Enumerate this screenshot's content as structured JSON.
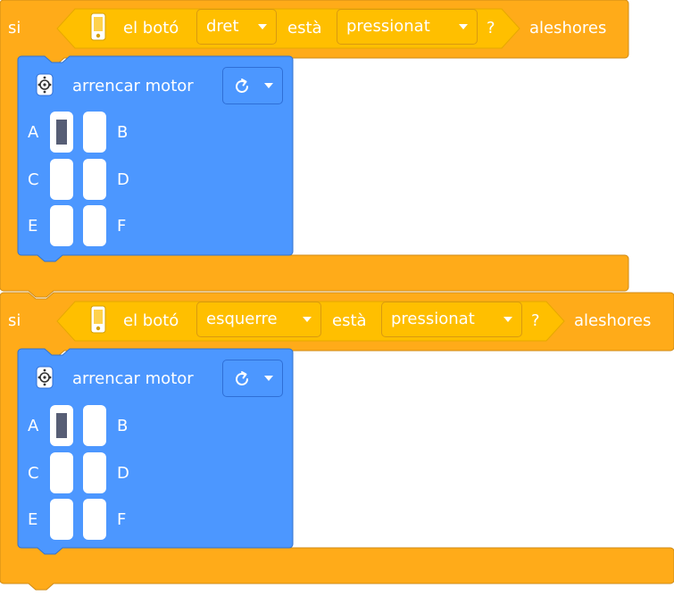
{
  "colors": {
    "control": "#ffab19",
    "control_dark": "#cf8b17",
    "sensing": "#ffbf00",
    "sensing_dark": "#e6a800",
    "motion": "#4c97ff",
    "motion_dark": "#3373cc",
    "port_active": "#575e75"
  },
  "blocks": [
    {
      "if_label": "si",
      "then_label": "aleshores",
      "condition": {
        "icon": "hub-icon",
        "text": "el botó",
        "button_value": "dret",
        "is_text": "està",
        "state_value": "pressionat",
        "question": "?"
      },
      "action": {
        "icon": "motor-icon",
        "text": "arrencar motor",
        "direction_icon": "rotate-clockwise-icon",
        "ports": [
          {
            "label": "A",
            "active": true
          },
          {
            "label": "B",
            "active": false
          },
          {
            "label": "C",
            "active": false
          },
          {
            "label": "D",
            "active": false
          },
          {
            "label": "E",
            "active": false
          },
          {
            "label": "F",
            "active": false
          }
        ]
      }
    },
    {
      "if_label": "si",
      "then_label": "aleshores",
      "condition": {
        "icon": "hub-icon",
        "text": "el botó",
        "button_value": "esquerre",
        "is_text": "està",
        "state_value": "pressionat",
        "question": "?"
      },
      "action": {
        "icon": "motor-icon",
        "text": "arrencar motor",
        "direction_icon": "rotate-clockwise-icon",
        "ports": [
          {
            "label": "A",
            "active": true
          },
          {
            "label": "B",
            "active": false
          },
          {
            "label": "C",
            "active": false
          },
          {
            "label": "D",
            "active": false
          },
          {
            "label": "E",
            "active": false
          },
          {
            "label": "F",
            "active": false
          }
        ]
      }
    }
  ]
}
